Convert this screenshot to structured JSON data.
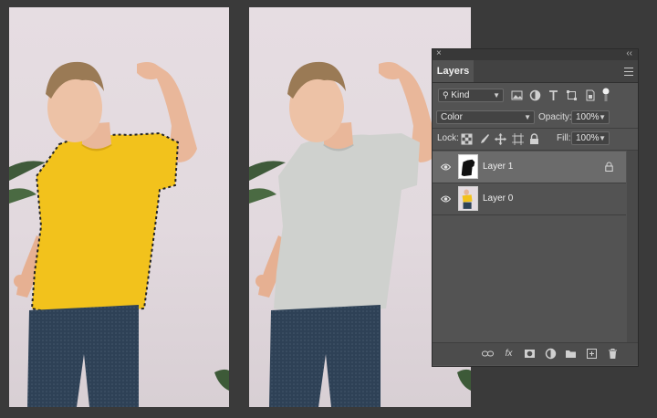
{
  "panel": {
    "close_glyph": "×",
    "collapse_glyph": "‹‹",
    "tab": "Layers",
    "filter_kind": "Kind",
    "blend_mode": "Color",
    "opacity_label": "Opacity:",
    "opacity_value": "100%",
    "lock_label": "Lock:",
    "fill_label": "Fill:",
    "fill_value": "100%"
  },
  "layers": [
    {
      "name": "Layer 1",
      "selected": true,
      "locked": true
    },
    {
      "name": "Layer 0",
      "selected": false,
      "locked": false
    }
  ],
  "colors": {
    "app_background": "#3a3a3a",
    "panel_background": "#535353",
    "selected_layer": "#6b6b6b",
    "shirt_original": "#f2c21c",
    "shirt_recolored": "#cfd1ce"
  },
  "icons": {
    "filter": [
      "image-filter-icon",
      "adjustment-filter-icon",
      "type-filter-icon",
      "shape-filter-icon",
      "smart-object-filter-icon",
      "filter-toggle-icon"
    ],
    "lock": [
      "lock-transparent-pixels-icon",
      "lock-image-pixels-icon",
      "lock-position-icon",
      "lock-artboard-icon",
      "lock-all-icon"
    ],
    "bottom": [
      "link-layers-icon",
      "layer-style-icon",
      "add-mask-icon",
      "adjustment-layer-icon",
      "group-icon",
      "new-layer-icon",
      "delete-layer-icon"
    ]
  },
  "bottom_fx_label": "fx"
}
